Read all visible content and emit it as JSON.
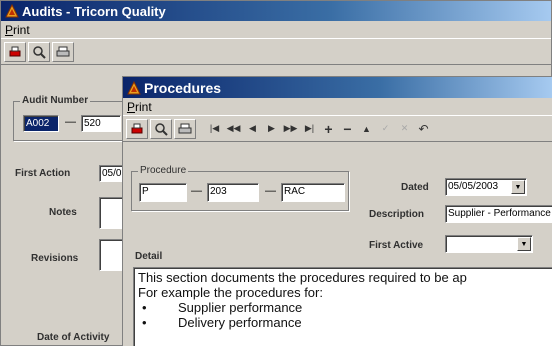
{
  "audits": {
    "title": "Audits - Tricorn Quality",
    "menu": [
      "Print"
    ],
    "audit_number_label": "Audit Number",
    "audit_number_part1": "A002",
    "audit_number_part2": "520",
    "first_action_label": "First Action",
    "first_action_value": "05/0",
    "notes_label": "Notes",
    "revisions_label": "Revisions",
    "date_of_activity_label": "Date of Activity"
  },
  "procedures": {
    "title": "Procedures",
    "menu": [
      "Print"
    ],
    "procedure_group_label": "Procedure",
    "procedure_part1": "P",
    "procedure_part2": "203",
    "procedure_part3": "RAC",
    "dated_label": "Dated",
    "dated_value": "05/05/2003",
    "description_label": "Description",
    "description_value": "Supplier - Performance",
    "first_active_label": "First Active",
    "first_active_value": "",
    "detail_label": "Detail",
    "detail_lines": [
      "This section documents the procedures required to be ap",
      "For example the procedures for:"
    ],
    "detail_bullets": [
      "Supplier performance",
      "Delivery performance"
    ],
    "bullet_char": "•"
  },
  "colors": {
    "titlebar": "#0a246a",
    "window_face": "#d4d0c8",
    "selection": "#0a246a"
  },
  "icons": [
    "app-icon",
    "print-icon",
    "search-icon",
    "printer-icon",
    "first-record-icon",
    "prev-page-icon",
    "prev-record-icon",
    "next-record-icon",
    "next-page-icon",
    "last-record-icon",
    "add-record-icon",
    "delete-record-icon",
    "up-icon",
    "confirm-icon",
    "cancel-icon",
    "undo-icon"
  ]
}
